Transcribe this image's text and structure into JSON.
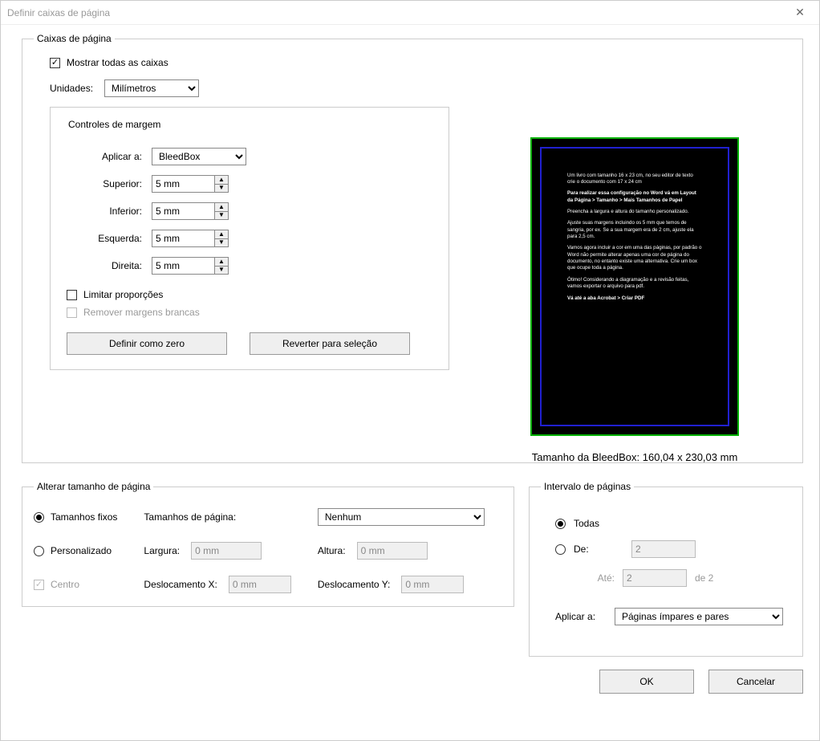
{
  "window": {
    "title": "Definir caixas de página"
  },
  "pageBoxes": {
    "legend": "Caixas de página",
    "showAllLabel": "Mostrar todas as caixas",
    "showAllChecked": true,
    "unitsLabel": "Unidades:",
    "unitsValue": "Milímetros",
    "marginControls": {
      "legend": "Controles de margem",
      "applyToLabel": "Aplicar a:",
      "applyToValue": "BleedBox",
      "top": {
        "label": "Superior:",
        "value": "5 mm"
      },
      "bottom": {
        "label": "Inferior:",
        "value": "5 mm"
      },
      "left": {
        "label": "Esquerda:",
        "value": "5 mm"
      },
      "right": {
        "label": "Direita:",
        "value": "5 mm"
      },
      "lockLabel": "Limitar proporções",
      "lockChecked": false,
      "removeWhiteLabel": "Remover margens brancas",
      "removeWhiteEnabled": false,
      "setZeroLabel": "Definir como zero",
      "revertLabel": "Reverter para seleção"
    }
  },
  "preview": {
    "caption": "Tamanho da BleedBox: 160,04 x 230,03 mm",
    "lines": [
      "Um livro com tamanho 16 x 23 cm, no seu editor de texto crie o documento com 17 x 24 cm",
      "Para realizar essa configuração no Word vá em Layout da Página > Tamanho > Mais Tamanhos de Papel",
      "Preencha a largura e altura do tamanho personalizado.",
      "Ajuste suas margens incluindo os 5 mm que temos de sangria, por ex. Se a sua margem era de 2 cm, ajuste ela para 2,5 cm.",
      "Vamos agora incluir a cor em uma das páginas, por padrão o Word não permite alterar apenas uma cor de página do documento, no entanto existe uma alternativa. Crie um box que ocupe toda a página.",
      "Ótimo! Considerando a diagramação e a revisão feitas, vamos exportar o arquivo para pdf.",
      "Vá até a aba Acrobat > Criar PDF"
    ]
  },
  "pageSize": {
    "legend": "Alterar tamanho de página",
    "fixedLabel": "Tamanhos fixos",
    "fixedSelected": true,
    "pageSizesLabel": "Tamanhos de página:",
    "pageSizesValue": "Nenhum",
    "customLabel": "Personalizado",
    "customSelected": false,
    "widthLabel": "Largura:",
    "widthValue": "0 mm",
    "heightLabel": "Altura:",
    "heightValue": "0 mm",
    "centerLabel": "Centro",
    "centerChecked": true,
    "offsetXLabel": "Deslocamento X:",
    "offsetXValue": "0 mm",
    "offsetYLabel": "Deslocamento Y:",
    "offsetYValue": "0 mm"
  },
  "pageRange": {
    "legend": "Intervalo de páginas",
    "allLabel": "Todas",
    "allSelected": true,
    "fromLabel": "De:",
    "fromSelected": false,
    "fromValue": "2",
    "toLabel": "Até:",
    "toValue": "2",
    "ofLabel": "de 2",
    "applyToLabel": "Aplicar a:",
    "applyToValue": "Páginas ímpares e pares"
  },
  "buttons": {
    "ok": "OK",
    "cancel": "Cancelar"
  }
}
